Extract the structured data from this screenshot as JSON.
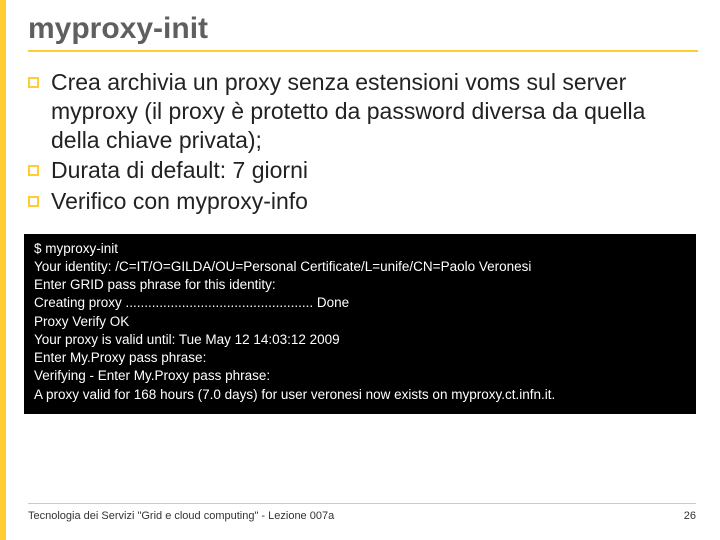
{
  "title": "myproxy-init",
  "bullets": [
    "Crea archivia un proxy senza estensioni voms sul server myproxy (il proxy è protetto da password diversa da quella della chiave privata);",
    "Durata di default: 7 giorni",
    "Verifico con myproxy-info"
  ],
  "terminal_lines": [
    "$ myproxy-init",
    "Your identity: /C=IT/O=GILDA/OU=Personal Certificate/L=unife/CN=Paolo Veronesi",
    "Enter GRID pass phrase for this identity:",
    "Creating proxy .................................................. Done",
    "Proxy Verify OK",
    "Your proxy is valid until: Tue May 12 14:03:12 2009",
    "Enter My.Proxy pass phrase:",
    "Verifying - Enter My.Proxy pass phrase:",
    "A proxy valid for 168 hours (7.0 days) for user veronesi now exists on myproxy.ct.infn.it."
  ],
  "footer_left": "Tecnologia dei Servizi \"Grid e cloud computing\" - Lezione 007a",
  "footer_right": "26"
}
